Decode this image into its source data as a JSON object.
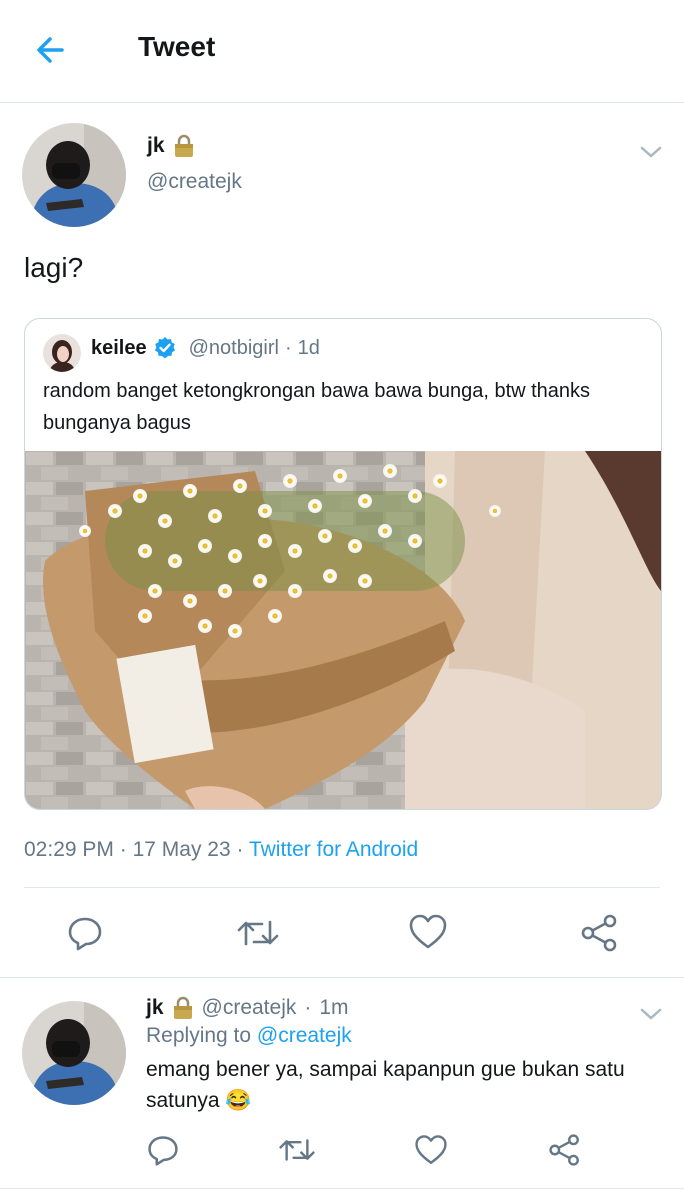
{
  "header": {
    "title": "Tweet"
  },
  "main_tweet": {
    "author_name": "jk",
    "author_handle": "@createjk",
    "text": "lagi?",
    "time": "02:29 PM",
    "date": "17 May 23",
    "source": "Twitter for Android",
    "separator": "·"
  },
  "quote": {
    "author_name": "keilee",
    "author_handle": "@notbigirl",
    "age": "1d",
    "text": "random banget ketongkrongan bawa bawa bunga, btw thanks bunganya bagus"
  },
  "reply": {
    "author_name": "jk",
    "author_handle": "@createjk",
    "age": "1m",
    "replying_prefix": "Replying to",
    "replying_to": "@createjk",
    "text": "emang bener ya, sampai kapanpun gue bukan satu satunya",
    "emoji": "😂"
  },
  "colors": {
    "accent": "#1da1f2",
    "secondary_text": "#657786",
    "border": "#e1e8ed"
  }
}
